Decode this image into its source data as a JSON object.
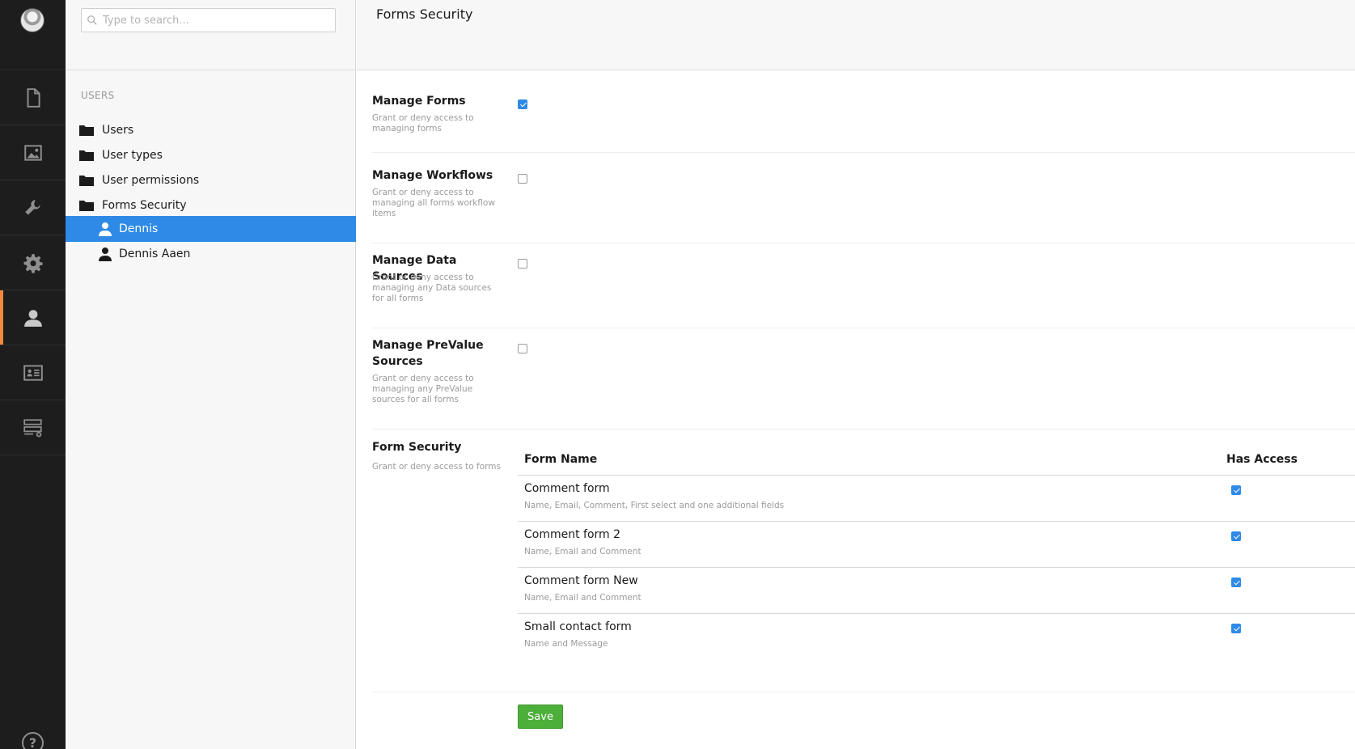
{
  "search": {
    "placeholder": "Type to search..."
  },
  "tree": {
    "root_label": "USERS",
    "nodes": [
      {
        "label": "Users",
        "icon": "folder-icon"
      },
      {
        "label": "User types",
        "icon": "folder-icon"
      },
      {
        "label": "User permissions",
        "icon": "folder-icon"
      },
      {
        "label": "Forms Security",
        "icon": "folder-icon"
      },
      {
        "label": "Dennis",
        "icon": "user-icon",
        "selected": true
      },
      {
        "label": "Dennis Aaen",
        "icon": "user-icon"
      }
    ]
  },
  "rail": {
    "items": [
      "content-icon",
      "media-icon",
      "developer-icon",
      "settings-icon",
      "users-icon",
      "members-icon",
      "forms-icon"
    ],
    "active": "users-icon",
    "accent": "#f5883a"
  },
  "page": {
    "title": "Forms Security"
  },
  "permissions": [
    {
      "label": "Manage Forms",
      "description": "Grant or deny access to managing forms",
      "checked": true
    },
    {
      "label": "Manage Workflows",
      "description": "Grant or deny access to managing all forms workflow items",
      "checked": false
    },
    {
      "label": "Manage Data Sources",
      "description": "Grant or deny access to managing any Data sources for all forms",
      "checked": false
    },
    {
      "label": "Manage PreValue Sources",
      "description": "Grant or deny access to managing any PreValue sources for all forms",
      "checked": false
    }
  ],
  "form_security": {
    "label": "Form Security",
    "description": "Grant or deny access to forms",
    "columns": {
      "name": "Form Name",
      "access": "Has Access"
    },
    "rows": [
      {
        "name": "Comment form",
        "fields": "Name, Email, Comment, First select and one additional fields",
        "has_access": true
      },
      {
        "name": "Comment form 2",
        "fields": "Name, Email and Comment",
        "has_access": true
      },
      {
        "name": "Comment form New",
        "fields": "Name, Email and Comment",
        "has_access": true
      },
      {
        "name": "Small contact form",
        "fields": "Name and Message",
        "has_access": true
      }
    ]
  },
  "actions": {
    "save_label": "Save"
  },
  "colors": {
    "selected": "#2e8ae6",
    "save": "#4caf3a",
    "rail": "#1d1d1d"
  }
}
